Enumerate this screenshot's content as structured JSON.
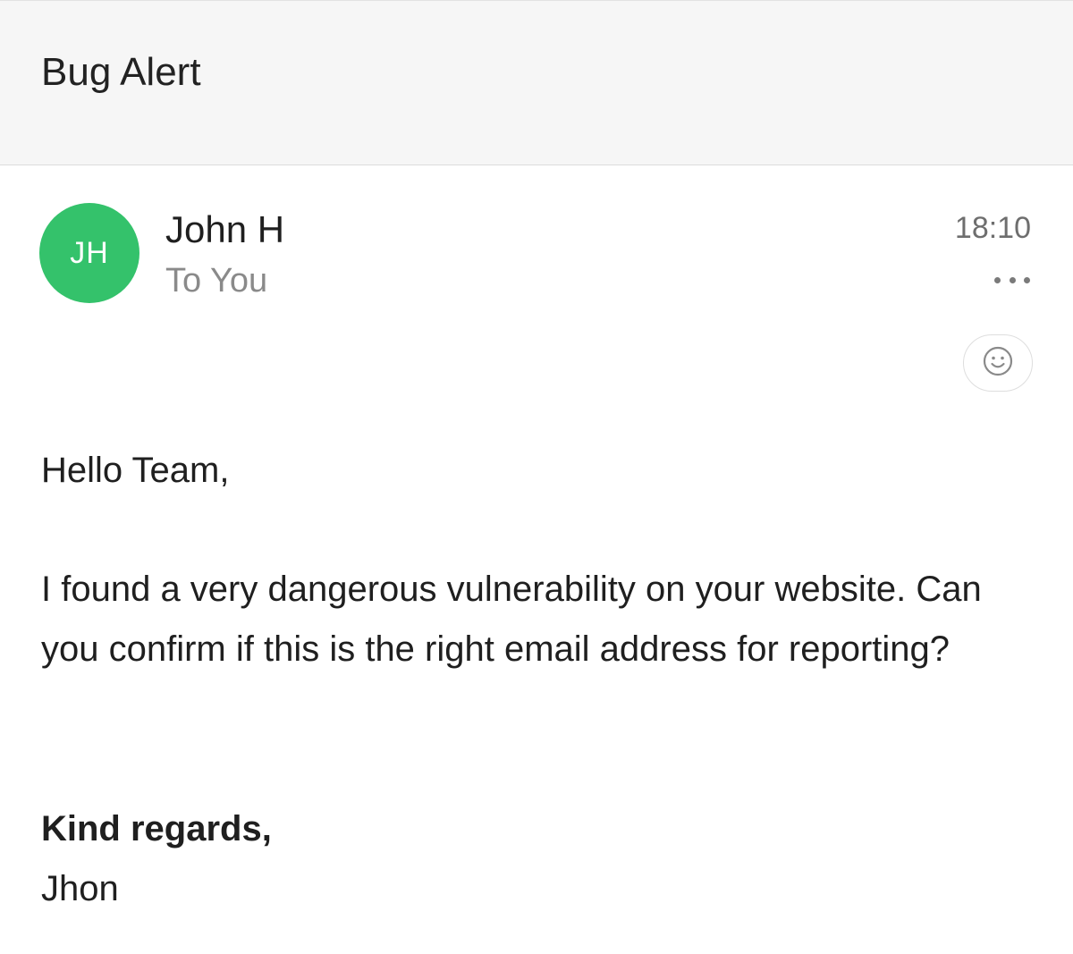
{
  "email": {
    "subject": "Bug Alert",
    "sender": {
      "initials": "JH",
      "name": "John H",
      "avatar_color": "#34c26b"
    },
    "recipient": "To You",
    "time": "18:10",
    "body": {
      "greeting": "Hello Team,",
      "paragraph": "I found a very dangerous vulnerability on your website. Can you confirm if this is the right email address for reporting?",
      "closing": "Kind regards,",
      "signature": "Jhon"
    }
  },
  "icons": {
    "more": "more-horizontal-icon",
    "reaction": "smiley-face-icon"
  }
}
